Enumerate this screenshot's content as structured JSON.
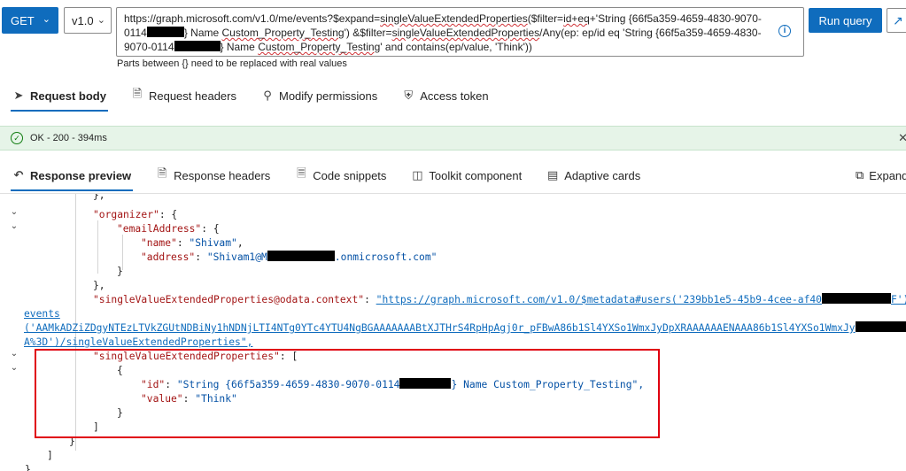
{
  "toolbar": {
    "method": "GET",
    "version": "v1.0",
    "url_lines": [
      [
        "https://graph.microsoft.com/v1.0/me/events?$expand=",
        "singleValueExtendedProperties",
        "($filter=",
        "id+eq",
        "+'String {66f5a359-4659-4830-9070-"
      ],
      [
        "0114",
        "",
        "} Name ",
        "Custom_Property_Testing",
        "') &$filter=",
        "singleValueExtendedProperties",
        "/Any(ep: ep/id eq 'String {66f5a359-4659-4830-"
      ],
      [
        "9070-0114",
        "",
        "} Name ",
        "Custom_Property_Testing",
        "' and contains(ep/value, 'Think'))"
      ]
    ],
    "hint": "Parts between {} need to be replaced with real values",
    "run_label": "Run query"
  },
  "request_tabs": [
    {
      "label": "Request body",
      "icon": "send-icon"
    },
    {
      "label": "Request headers",
      "icon": "document-icon"
    },
    {
      "label": "Modify permissions",
      "icon": "key-icon"
    },
    {
      "label": "Access token",
      "icon": "shield-icon"
    }
  ],
  "status": {
    "text": "OK - 200 - 394ms",
    "color": "#107c10"
  },
  "response_tabs": [
    {
      "label": "Response preview",
      "icon": "undo-icon"
    },
    {
      "label": "Response headers",
      "icon": "document-icon"
    },
    {
      "label": "Code snippets",
      "icon": "code-icon"
    },
    {
      "label": "Toolkit component",
      "icon": "toolkit-icon"
    },
    {
      "label": "Adaptive cards",
      "icon": "card-icon"
    }
  ],
  "expand_label": "Expand",
  "code": {
    "top_brace": "},",
    "organizer_key": "\"organizer\"",
    "email_key": "\"emailAddress\"",
    "name_key": "\"name\"",
    "name_value": "\"Shivam\"",
    "address_key": "\"address\"",
    "address_value_start": "\"Shivam1@M",
    "address_value_end": ".onmicrosoft.com\"",
    "close_inner": "}",
    "close_org": "},",
    "context_key": "\"singleValueExtendedProperties@odata.context\"",
    "context_link_start": "\"https://graph.microsoft.com/v1.0/$metadata#users('239bb1e5-45b9-4cee-af40",
    "context_link_end": "F')/",
    "context_cont1": "events",
    "context_cont2": "('AAMkADZiZDgyNTEzLTVkZGUtNDBiNy1hNDNjLTI4NTg0YTc4YTU4NgBGAAAAAAABtXJTHrS4RpHpAgj0r_pFBwA86b1Sl4YXSo1WmxJyDpXRAAAAAAENAAA86b1Sl4YXSo1WmxJy",
    "context_cont2_end": "A",
    "context_cont3": "A%3D')/singleValueExtendedProperties\",",
    "svep_key": "\"singleValueExtendedProperties\"",
    "open_bracket": "[",
    "open_obj": "{",
    "id_key": "\"id\"",
    "id_value_start": "\"String {66f5a359-4659-4830-9070-0114",
    "id_value_end": "} Name Custom_Property_Testing\",",
    "value_key": "\"value\"",
    "value_value": "\"Think\"",
    "close_obj": "}",
    "close_bracket": "]",
    "close_event": "}",
    "close_array": "]",
    "close_root": "}"
  }
}
